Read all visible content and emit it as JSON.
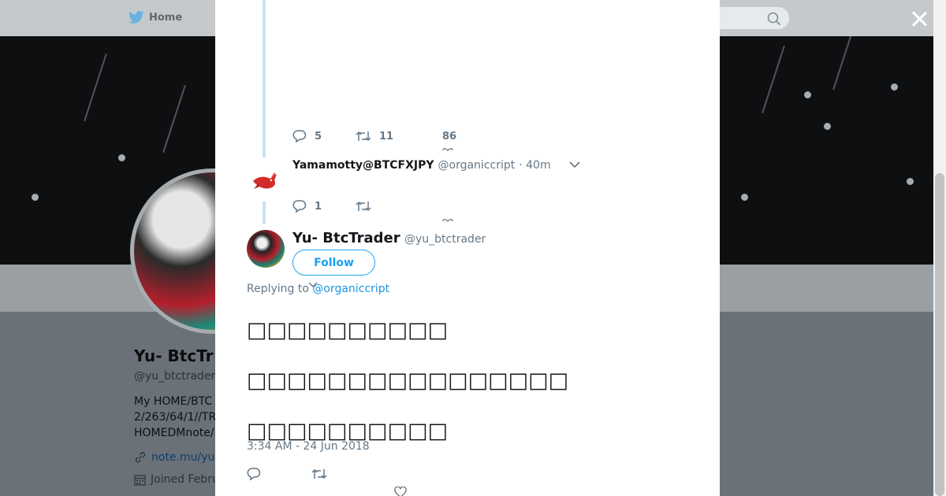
{
  "background": {
    "nav_home_label": "Home",
    "profile_name": "Yu- BtcTr",
    "profile_handle": "@yu_btctrader",
    "bio_lines": [
      "My HOME/BTC",
      "2/263/64/1//TR",
      "HOMEDMnote/"
    ],
    "link_text": "note.mu/yu",
    "joined_text": "Joined Febru"
  },
  "icons": {
    "twitter_bird": "twitter-bird-icon",
    "search": "search-icon",
    "close": "close-icon",
    "reply": "reply-icon",
    "retweet": "retweet-icon",
    "like": "heart-icon",
    "caret": "chevron-down-icon",
    "link": "link-icon",
    "calendar": "calendar-icon"
  },
  "colors": {
    "accent": "#1da1f2",
    "link": "#1b95e0",
    "muted": "#657786",
    "thread_line": "#c4e3f5"
  },
  "modal": {
    "parent_stats": {
      "replies": "5",
      "retweets": "11",
      "likes": "86"
    },
    "reply_tweet": {
      "name": "Yamamotty@BTCFXJPY",
      "handle": "@organiccript",
      "time": "· 40m",
      "stats": {
        "replies": "1"
      }
    },
    "focused_tweet": {
      "name": "Yu- BtcTrader",
      "handle": "@yu_btctrader",
      "follow_label": "Follow",
      "replying_to_prefix": "Replying to",
      "replying_to_handle": "@organiccript",
      "text_lines": [
        "□□□□□□□□□□",
        "□□□□□□□□□□□□□□□□",
        "□□□□□□□□□□"
      ],
      "timestamp": "3:34 AM - 24 Jun 2018"
    }
  }
}
